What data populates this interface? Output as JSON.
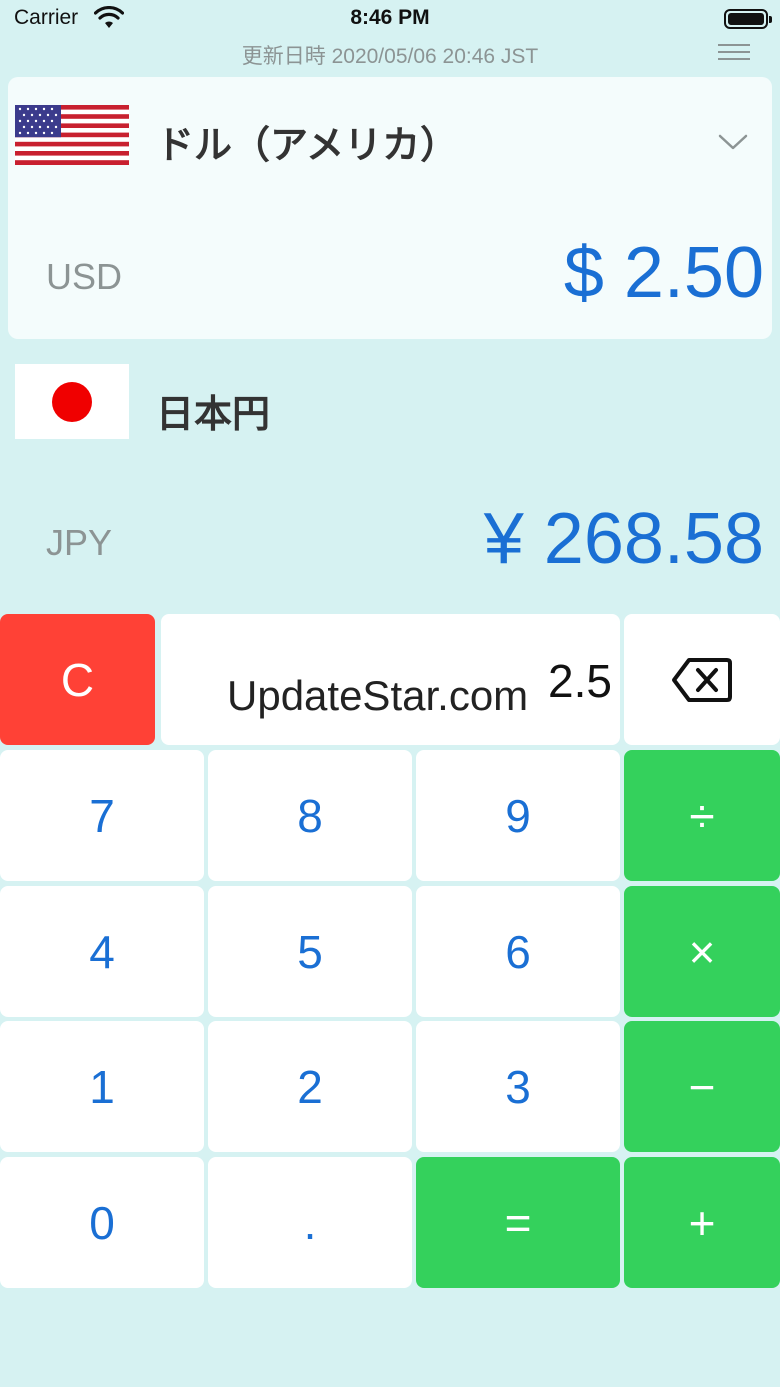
{
  "status_bar": {
    "carrier": "Carrier",
    "time": "8:46 PM"
  },
  "header": {
    "updated": "更新日時 2020/05/06 20:46 JST"
  },
  "from_currency": {
    "name": "ドル（アメリカ）",
    "code": "USD",
    "amount": "$ 2.50"
  },
  "to_currency": {
    "name": "日本円",
    "code": "JPY",
    "amount": "¥ 268.58"
  },
  "display": {
    "value": "2.5",
    "watermark": "UpdateStar.com"
  },
  "keypad": {
    "clear": "C",
    "digits": [
      "0",
      "1",
      "2",
      "3",
      "4",
      "5",
      "6",
      "7",
      "8",
      "9"
    ],
    "dot": ".",
    "divide": "÷",
    "multiply": "×",
    "minus": "−",
    "plus": "+",
    "equals": "="
  },
  "colors": {
    "background": "#d6f2f2",
    "accent_blue": "#1a6fd4",
    "operator_green": "#34d15c",
    "clear_red": "#ff4136"
  },
  "icons": {
    "menu": "hamburger-icon",
    "dropdown": "chevron-down-icon",
    "backspace": "backspace-icon"
  }
}
